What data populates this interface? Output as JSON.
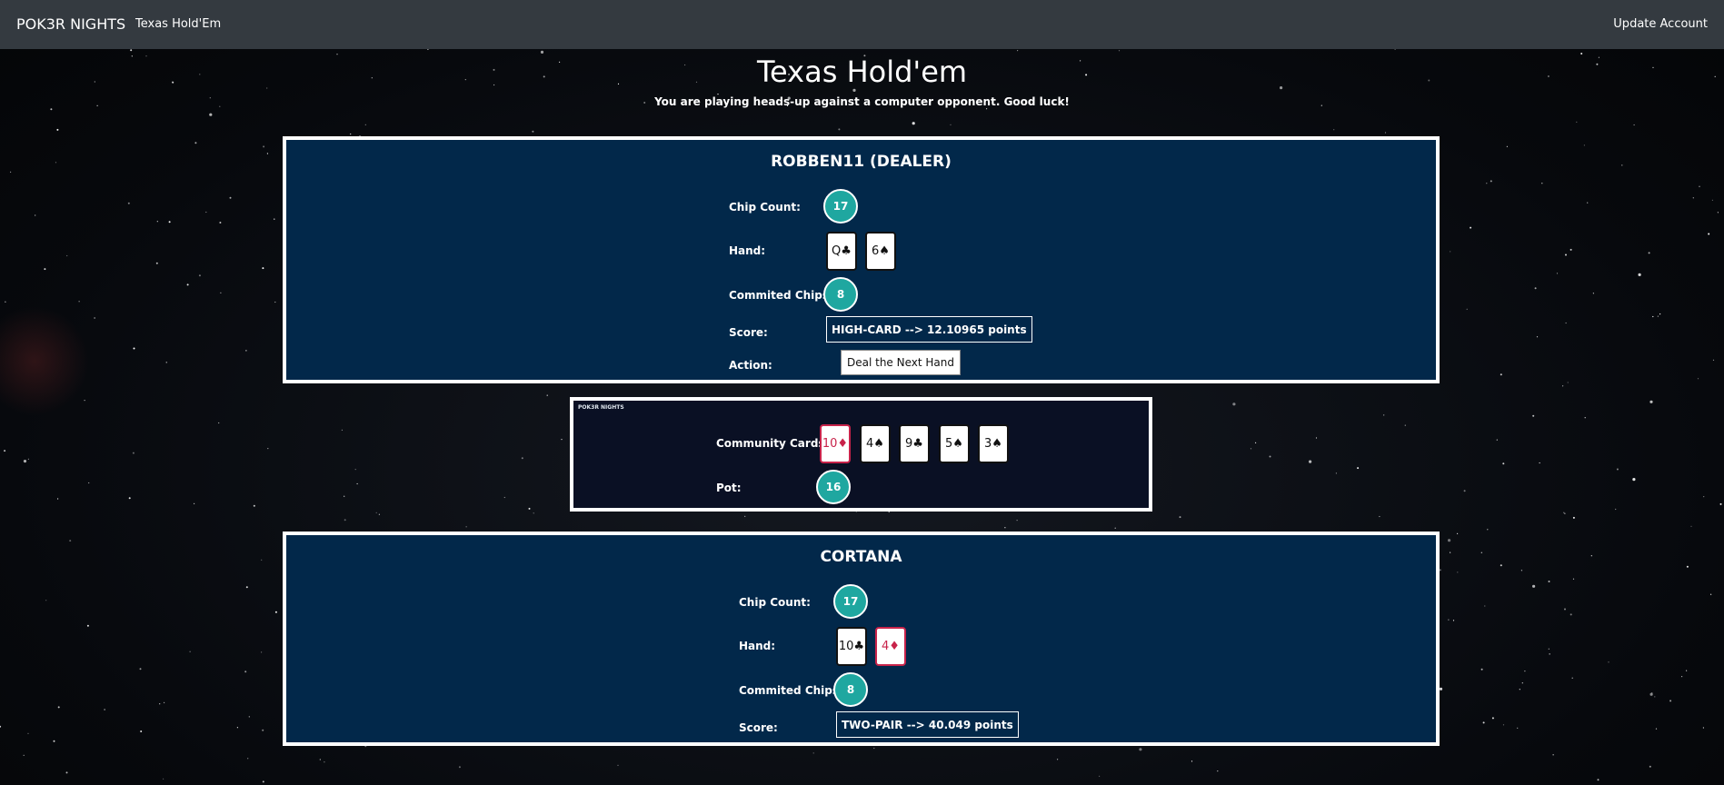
{
  "navbar": {
    "brand": "POK3R NIGHTS",
    "game_link": "Texas Hold'Em",
    "account_link": "Update Account"
  },
  "header": {
    "title": "Texas Hold'em",
    "subtitle": "You are playing heads-up against a computer opponent. Good luck!"
  },
  "dealer": {
    "name": "ROBBEN11 (DEALER)",
    "chip_count_label": "Chip Count:",
    "chip_count": "17",
    "hand_label": "Hand:",
    "hand": [
      {
        "text": "Q♣",
        "color": "#111111"
      },
      {
        "text": "6♠",
        "color": "#111111"
      }
    ],
    "committed_label": "Commited Chips:",
    "committed": "8",
    "score_label": "Score:",
    "score": "HIGH-CARD --> 12.10965 points",
    "action_label": "Action:",
    "action_button": "Deal the Next Hand"
  },
  "community": {
    "brand": "POK3R NIGHTS",
    "cards_label": "Community Cards:",
    "cards": [
      {
        "text": "10♦",
        "color": "#c8234a"
      },
      {
        "text": "4♠",
        "color": "#111111"
      },
      {
        "text": "9♣",
        "color": "#111111"
      },
      {
        "text": "5♠",
        "color": "#111111"
      },
      {
        "text": "3♠",
        "color": "#111111"
      }
    ],
    "pot_label": "Pot:",
    "pot": "16"
  },
  "player": {
    "name": "CORTANA",
    "chip_count_label": "Chip Count:",
    "chip_count": "17",
    "hand_label": "Hand:",
    "hand": [
      {
        "text": "10♣",
        "color": "#111111"
      },
      {
        "text": "4♦",
        "color": "#c8234a"
      }
    ],
    "committed_label": "Commited Chips:",
    "committed": "8",
    "score_label": "Score:",
    "score": "TWO-PAIR --> 40.049 points"
  },
  "colors": {
    "navbar": "#343a40",
    "panel": "#02284a",
    "community_panel": "#0a1024",
    "chip": "#1fa7a0",
    "red_suit": "#c8234a"
  }
}
